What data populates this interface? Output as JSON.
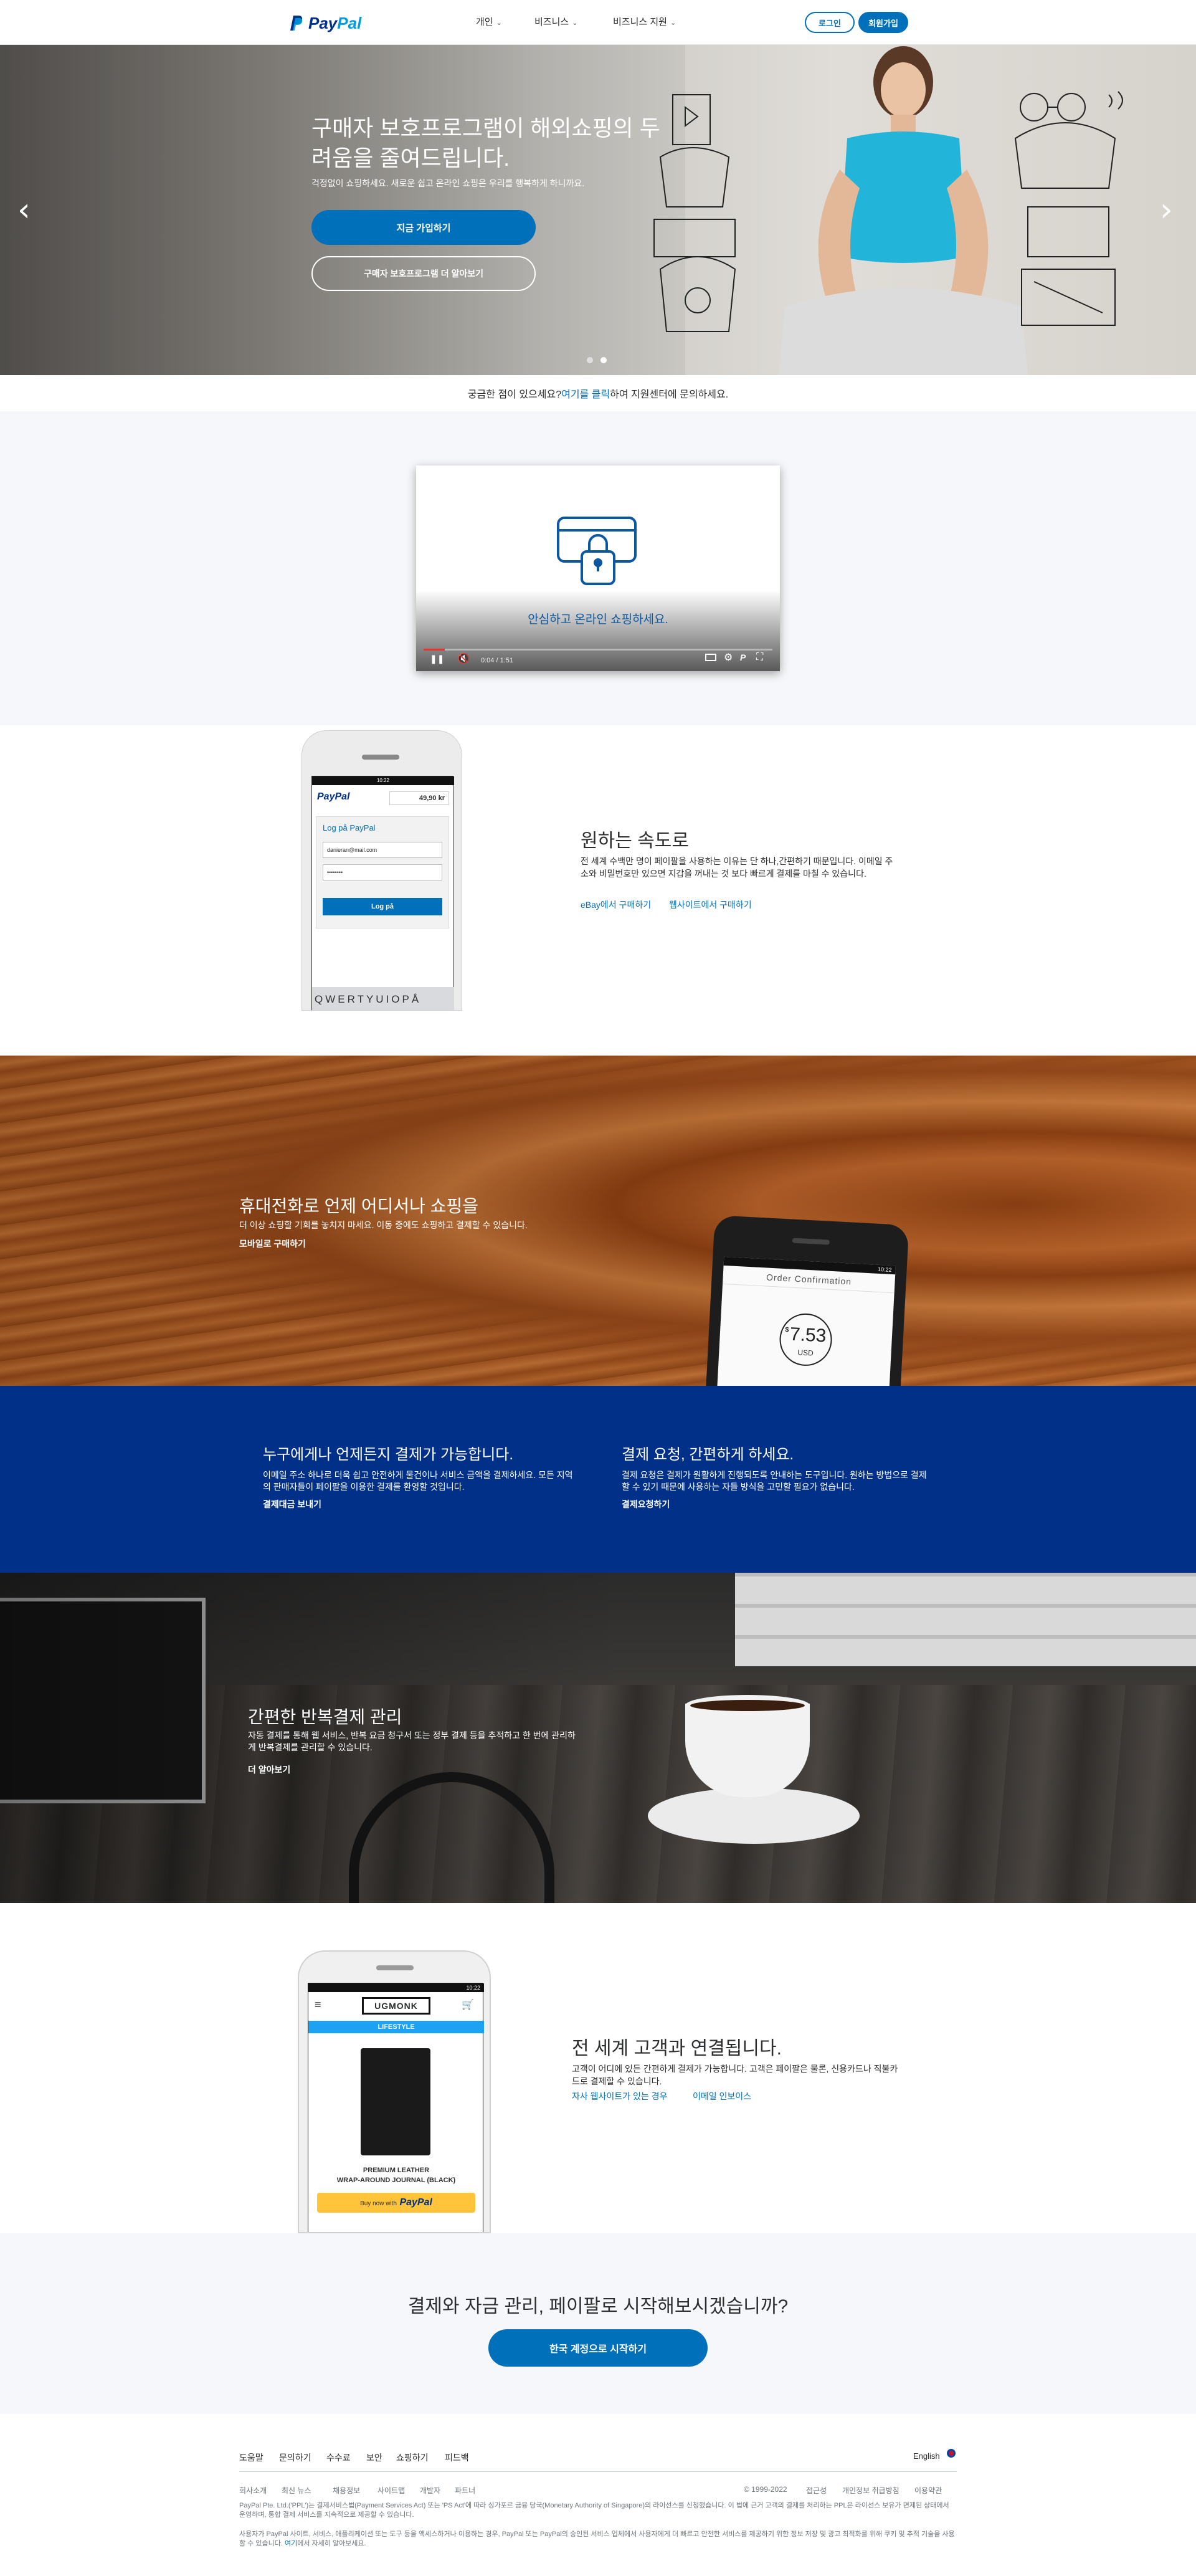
{
  "header": {
    "logo_text_pay": "Pay",
    "logo_text_pal": "Pal",
    "nav": [
      {
        "label": "개인"
      },
      {
        "label": "비즈니스"
      },
      {
        "label": "비즈니스 지원"
      }
    ],
    "login_label": "로그인",
    "signup_label": "회원가입"
  },
  "hero": {
    "title": "구매자 보호프로그램이 해외쇼핑의 두려움을 줄여드립니다.",
    "subtitle": "걱정없이 쇼핑하세요. 새로운 쉽고 온라인 쇼핑은 우리를 행복하게 하니까요.",
    "cta_primary": "지금 가입하기",
    "cta_secondary": "구매자 보호프로그램 더 알아보기",
    "prev_glyph": "‹",
    "next_glyph": "›"
  },
  "help_bar": {
    "prefix": "궁금한 점이 있으세요? ",
    "link": "여기를 클릭",
    "suffix": "하여 지원센터에 문의하세요."
  },
  "video": {
    "caption": "안심하고 온라인 쇼핑하세요.",
    "time": "0:04 / 1:51",
    "progress": 0.06
  },
  "speed": {
    "title": "원하는 속도로",
    "text": "전 세계 수백만 명이 페이팔을 사용하는 이유는 단 하나,간편하기 때문입니다. 이메일 주소와 비밀번호만 있으면 지갑을 꺼내는 것 보다 빠르게 결제를 마칠 수 있습니다.",
    "link1": "eBay에서 구매하기",
    "link2": "웹사이트에서 구매하기",
    "phone": {
      "time": "10:22",
      "logo": "PayPal",
      "amount": "49,90 kr",
      "login_title": "Log på PayPal",
      "email": "danieran@mail.com",
      "password": "••••••••",
      "button": "Log på",
      "keys": "QWERTYUIOPÅ"
    }
  },
  "mobile": {
    "title": "휴대전화로 언제 어디서나 쇼핑을",
    "text": "더 이상 쇼핑할 기회를 놓치지 마세요. 이동 중에도 쇼핑하고 결제할 수 있습니다.",
    "link": "모바일로 구매하기",
    "phone": {
      "time": "10:22",
      "header": "Order Confirmation",
      "amount": "7.53",
      "currency": "USD"
    }
  },
  "blue": {
    "left_title": "누구에게나 언제든지 결제가 가능합니다.",
    "left_text": "이메일 주소 하나로 더욱 쉽고 안전하게 물건이나 서비스 금액을 결제하세요. 모든 지역의 판매자들이 페이팔을 이용한 결제를 환영할 것입니다.",
    "left_link": "결제대금 보내기",
    "right_title": "결제 요청, 간편하게 하세요.",
    "right_text": "결제 요청은 결제가 원활하게 진행되도록 안내하는 도구입니다. 원하는 방법으로 결제할 수 있기 때문에 사용하는 자들 방식을 고민할 필요가 없습니다.",
    "right_link": "결제요청하기"
  },
  "recurring": {
    "title": "간편한 반복결제 관리",
    "text": "자동 결제를 통해 웹 서비스, 반복 요금 청구서 또는 정부 결제 등을 추적하고 한 번에 관리하게 반복결제를 관리할 수 있습니다.",
    "link": "더 알아보기"
  },
  "global": {
    "title": "전 세계 고객과 연결됩니다.",
    "text": "고객이 어디에 있든 간편하게 결제가 가능합니다. 고객은 페이팔은 물론, 신용카드나 직불카드로 결제할 수 있습니다.",
    "link1": "자사 웹사이트가 있는 경우",
    "link2": "이메일 인보이스",
    "phone": {
      "time": "10:22",
      "brand": "UGMONK",
      "menu_label": "LIFESTYLE",
      "product_line1": "PREMIUM LEATHER",
      "product_line2": "WRAP-AROUND JOURNAL (BLACK)",
      "buy_prefix": "Buy now with",
      "buy_brand": "PayPal"
    }
  },
  "start": {
    "title": "결제와 자금 관리, 페이팔로 시작해보시겠습니까?",
    "button": "한국 계정으로 시작하기"
  },
  "footer": {
    "nav": [
      "도움말",
      "문의하기",
      "수수료",
      "보안",
      "쇼핑하기",
      "피드백"
    ],
    "language": "English",
    "sub": [
      "회사소개",
      "최신 뉴스",
      "채용정보",
      "사이트맵",
      "개발자",
      "파트너"
    ],
    "copyright": "© 1999-2022",
    "sub_right": [
      "접근성",
      "개인정보 취급방침",
      "이용약관"
    ],
    "legal1": "PayPal Pte. Ltd.('PPL')는 결제서비스법(Payment Services Act) 또는 'PS Act'에 따라 싱가포르 금융 당국(Monetary Authority of Singapore)의 라이선스를 신청했습니다. 이 법에 근거 고객의 결제를 처리하는 PPL은 라이선스 보유가 면제된 상태에서 운영하며, 통합 결제 서비스를 지속적으로 제공할 수 있습니다.",
    "legal2_prefix": "사용자가 PayPal 사이트, 서비스, 애플리케이션 또는 도구 등을 액세스하거나 이용하는 경우, PayPal 또는 PayPal의 승인된 서비스 업체에서 사용자에게 더 빠르고 안전한 서비스를 제공하기 위한 정보 저장 및 광고 최적화를 위해 쿠키 및 추적 기술을 사용할 수 있습니다. ",
    "legal2_link": "여기",
    "legal2_suffix": "에서 자세히 알아보세요."
  },
  "colors": {
    "brand_blue": "#0070ba",
    "navy": "#003087",
    "light_bg": "#f5f7fa"
  }
}
